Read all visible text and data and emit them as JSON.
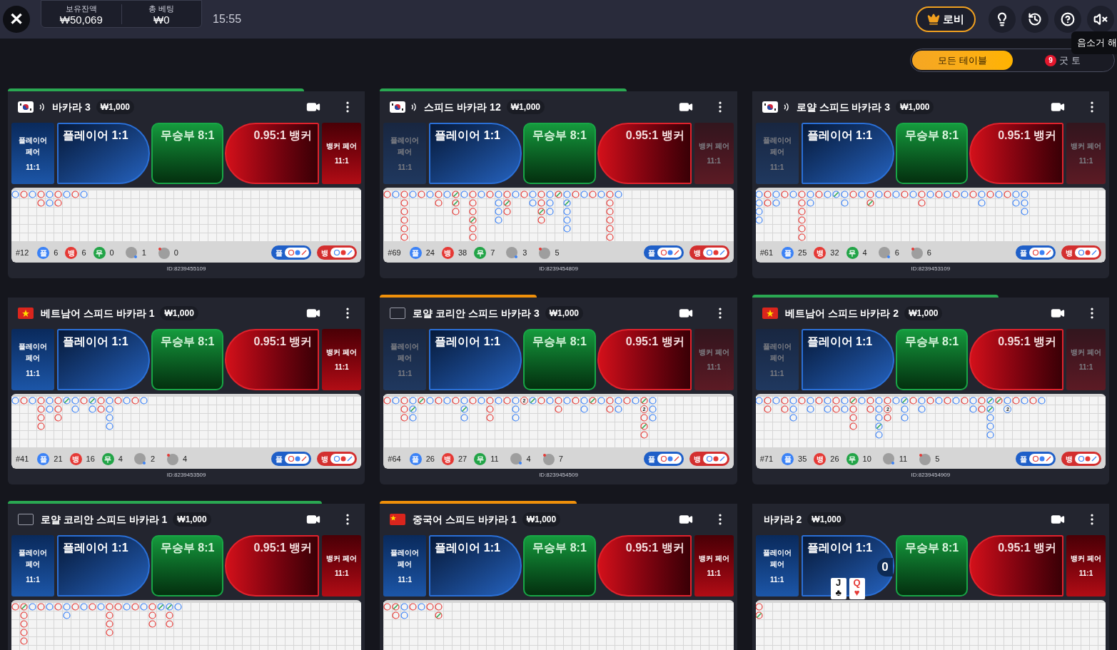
{
  "top_bar": {
    "close": "✕",
    "balance": {
      "label": "보유잔액",
      "value": "₩50,069"
    },
    "total_bet": {
      "label": "총 베팅",
      "value": "₩0"
    },
    "time": "15:55",
    "lobby": "로비",
    "tooltip": "음소거 해"
  },
  "tabs": [
    {
      "label": "모든 테이블",
      "selected": true
    },
    {
      "label": "굿 토",
      "selected": false,
      "badge": "9"
    }
  ],
  "tables": [
    {
      "flag": {
        "kind": "kr"
      },
      "sound": true,
      "title": "바카라 3",
      "min_bet": "₩1,000",
      "timer": {
        "level": 0.83,
        "color": "#2aa852"
      },
      "pairs_open": true,
      "player_pair": {
        "label": "플레이어 페어",
        "odds": "11:1"
      },
      "player": "플레이어 1:1",
      "tie": "무승부 8:1",
      "banker": "0.95:1 뱅커",
      "banker_pair": {
        "label": "뱅커 페어",
        "odds": "11:1"
      },
      "road": [
        [
          {
            "kind": "player"
          }
        ],
        [
          {
            "kind": "banker"
          }
        ],
        [
          {
            "kind": "player"
          }
        ],
        [
          {
            "kind": "banker"
          },
          {
            "kind": "banker"
          }
        ],
        [
          {
            "kind": "player"
          },
          {
            "kind": "player"
          }
        ],
        [
          {
            "kind": "banker"
          },
          {
            "kind": "banker"
          }
        ],
        [
          {
            "kind": "player"
          }
        ],
        [
          {
            "kind": "banker"
          }
        ],
        [
          {
            "kind": "player"
          }
        ]
      ],
      "stats": {
        "shoe": "#12",
        "player": {
          "label": "플",
          "count": "6"
        },
        "banker": {
          "label": "뱅",
          "count": "6"
        },
        "tie": {
          "label": "무",
          "count": "0"
        },
        "player_pair": "1",
        "banker_pair": "0"
      },
      "predict": [
        "플",
        "뱅"
      ],
      "id": "ID:8239455109"
    },
    {
      "flag": {
        "kind": "kr"
      },
      "sound": true,
      "title": "스피드 바카라 12",
      "min_bet": "₩1,000",
      "timer": {
        "level": 0.69,
        "color": "#2aa852"
      },
      "pairs_open": false,
      "player_pair": {
        "label": "플레이어 페어",
        "odds": "11:1"
      },
      "player": "플레이어 1:1",
      "tie": "무승부 8:1",
      "banker": "0.95:1 뱅커",
      "banker_pair": {
        "label": "뱅커 페어",
        "odds": "11:1"
      },
      "road": [
        [
          {
            "kind": "banker"
          }
        ],
        [
          {
            "kind": "player"
          }
        ],
        [
          {
            "kind": "banker"
          },
          {
            "kind": "banker"
          },
          {
            "kind": "banker"
          },
          {
            "kind": "banker"
          },
          {
            "kind": "banker"
          },
          {
            "kind": "banker"
          }
        ],
        [
          {
            "kind": "player"
          }
        ],
        [
          {
            "kind": "banker"
          }
        ],
        [
          {
            "kind": "player"
          }
        ],
        [
          {
            "kind": "banker"
          },
          {
            "kind": "banker"
          }
        ],
        [
          {
            "kind": "player"
          }
        ],
        [
          {
            "kind": "banker_tie"
          },
          {
            "kind": "banker_tie"
          },
          {
            "kind": "banker"
          }
        ],
        [
          {
            "kind": "player"
          }
        ],
        [
          {
            "kind": "banker"
          },
          {
            "kind": "banker"
          },
          {
            "kind": "banker"
          },
          {
            "kind": "banker_tie"
          },
          {
            "kind": "banker"
          },
          {
            "kind": "banker"
          }
        ],
        [
          {
            "kind": "player"
          }
        ],
        [
          {
            "kind": "banker"
          }
        ],
        [
          {
            "kind": "player"
          },
          {
            "kind": "player"
          },
          {
            "kind": "player"
          },
          {
            "kind": "player"
          }
        ],
        [
          {
            "kind": "banker"
          },
          {
            "kind": "banker_tie"
          },
          {
            "kind": "banker"
          }
        ],
        [
          {
            "kind": "player"
          }
        ],
        [
          {
            "kind": "banker"
          }
        ],
        [
          {
            "kind": "player"
          },
          {
            "kind": "player"
          }
        ],
        [
          {
            "kind": "banker"
          },
          {
            "kind": "banker"
          },
          {
            "kind": "banker_tie"
          },
          {
            "kind": "banker"
          }
        ],
        [
          {
            "kind": "player"
          },
          {
            "kind": "player"
          },
          {
            "kind": "player"
          }
        ],
        [
          {
            "kind": "banker_tie"
          }
        ],
        [
          {
            "kind": "player"
          },
          {
            "kind": "player_tie"
          },
          {
            "kind": "player"
          },
          {
            "kind": "player"
          },
          {
            "kind": "player"
          }
        ],
        [
          {
            "kind": "banker"
          }
        ],
        [
          {
            "kind": "player"
          }
        ],
        [
          {
            "kind": "banker"
          }
        ],
        [
          {
            "kind": "player"
          }
        ],
        [
          {
            "kind": "banker"
          },
          {
            "kind": "banker"
          },
          {
            "kind": "banker"
          },
          {
            "kind": "banker"
          },
          {
            "kind": "banker"
          },
          {
            "kind": "banker"
          }
        ],
        [
          {
            "kind": "player"
          }
        ]
      ],
      "stats": {
        "shoe": "#69",
        "player": {
          "label": "플",
          "count": "24"
        },
        "banker": {
          "label": "뱅",
          "count": "38"
        },
        "tie": {
          "label": "무",
          "count": "7"
        },
        "player_pair": "3",
        "banker_pair": "5"
      },
      "predict": [
        "플",
        "뱅"
      ],
      "id": "ID:8239454809"
    },
    {
      "flag": {
        "kind": "kr"
      },
      "sound": true,
      "title": "로얄 스피드 바카라 3",
      "min_bet": "₩1,000",
      "pairs_open": false,
      "player_pair": {
        "label": "플레이어 페어",
        "odds": "11:1"
      },
      "player": "플레이어 1:1",
      "tie": "무승부 8:1",
      "banker": "0.95:1 뱅커",
      "banker_pair": {
        "label": "뱅커 페어",
        "odds": "11:1"
      },
      "road": [
        [
          {
            "kind": "player"
          },
          {
            "kind": "player"
          },
          {
            "kind": "player"
          },
          {
            "kind": "player"
          }
        ],
        [
          {
            "kind": "banker"
          },
          {
            "kind": "banker"
          }
        ],
        [
          {
            "kind": "player"
          },
          {
            "kind": "player"
          }
        ],
        [
          {
            "kind": "banker"
          }
        ],
        [
          {
            "kind": "player"
          }
        ],
        [
          {
            "kind": "banker"
          },
          {
            "kind": "banker"
          },
          {
            "kind": "banker"
          },
          {
            "kind": "banker"
          },
          {
            "kind": "banker"
          },
          {
            "kind": "banker"
          }
        ],
        [
          {
            "kind": "player"
          },
          {
            "kind": "player"
          }
        ],
        [
          {
            "kind": "banker"
          }
        ],
        [
          {
            "kind": "player"
          }
        ],
        [
          {
            "kind": "player_tie"
          }
        ],
        [
          {
            "kind": "player"
          },
          {
            "kind": "player"
          }
        ],
        [
          {
            "kind": "banker"
          }
        ],
        [
          {
            "kind": "player"
          }
        ],
        [
          {
            "kind": "banker"
          },
          {
            "kind": "banker_tie"
          }
        ],
        [
          {
            "kind": "player"
          }
        ],
        [
          {
            "kind": "banker"
          }
        ],
        [
          {
            "kind": "player"
          }
        ],
        [
          {
            "kind": "banker"
          }
        ],
        [
          {
            "kind": "player"
          }
        ],
        [
          {
            "kind": "banker"
          },
          {
            "kind": "banker"
          }
        ],
        [
          {
            "kind": "player"
          }
        ],
        [
          {
            "kind": "banker"
          }
        ],
        [
          {
            "kind": "player"
          }
        ],
        [
          {
            "kind": "banker"
          }
        ],
        [
          {
            "kind": "player"
          }
        ],
        [
          {
            "kind": "banker"
          }
        ],
        [
          {
            "kind": "player"
          },
          {
            "kind": "player"
          }
        ],
        [
          {
            "kind": "banker"
          }
        ],
        [
          {
            "kind": "player"
          }
        ],
        [
          {
            "kind": "banker"
          }
        ],
        [
          {
            "kind": "player"
          },
          {
            "kind": "player"
          }
        ],
        [
          {
            "kind": "player"
          },
          {
            "kind": "player"
          },
          {
            "kind": "player"
          }
        ]
      ],
      "stats": {
        "shoe": "#61",
        "player": {
          "label": "플",
          "count": "25"
        },
        "banker": {
          "label": "뱅",
          "count": "32"
        },
        "tie": {
          "label": "무",
          "count": "4"
        },
        "player_pair": "6",
        "banker_pair": "6"
      },
      "predict": [
        "플",
        "뱅"
      ],
      "id": "ID:8239453109"
    },
    {
      "flag": {
        "kind": "vn"
      },
      "sound": false,
      "title": "베트남어 스피드 바카라 1",
      "min_bet": "₩1,000",
      "pairs_open": true,
      "player_pair": {
        "label": "플레이어 페어",
        "odds": "11:1"
      },
      "player": "플레이어 1:1",
      "tie": "무승부 8:1",
      "banker": "0.95:1 뱅커",
      "banker_pair": {
        "label": "뱅커 페어",
        "odds": "11:1"
      },
      "road": [
        [
          {
            "kind": "player"
          }
        ],
        [
          {
            "kind": "banker"
          }
        ],
        [
          {
            "kind": "player"
          }
        ],
        [
          {
            "kind": "banker"
          },
          {
            "kind": "banker"
          },
          {
            "kind": "banker"
          },
          {
            "kind": "banker"
          }
        ],
        [
          {
            "kind": "player"
          },
          {
            "kind": "player"
          }
        ],
        [
          {
            "kind": "banker"
          },
          {
            "kind": "banker"
          },
          {
            "kind": "banker"
          }
        ],
        [
          {
            "kind": "player_tie"
          }
        ],
        [
          {
            "kind": "player"
          },
          {
            "kind": "player"
          }
        ],
        [
          {
            "kind": "banker"
          }
        ],
        [
          {
            "kind": "player_tie"
          },
          {
            "kind": "player"
          }
        ],
        [
          {
            "kind": "banker"
          },
          {
            "kind": "banker"
          }
        ],
        [
          {
            "kind": "player"
          },
          {
            "kind": "player"
          },
          {
            "kind": "player"
          },
          {
            "kind": "player"
          }
        ],
        [
          {
            "kind": "banker"
          }
        ],
        [
          {
            "kind": "player"
          }
        ],
        [
          {
            "kind": "banker"
          }
        ],
        [
          {
            "kind": "player"
          }
        ]
      ],
      "stats": {
        "shoe": "#41",
        "player": {
          "label": "플",
          "count": "21"
        },
        "banker": {
          "label": "뱅",
          "count": "16"
        },
        "tie": {
          "label": "무",
          "count": "4"
        },
        "player_pair": "2",
        "banker_pair": "4"
      },
      "predict": [
        "플",
        "뱅"
      ],
      "id": "ID:8239453509"
    },
    {
      "flag": {
        "kind": "blank"
      },
      "sound": false,
      "title": "로얄 코리안 스피드 바카라 3",
      "min_bet": "₩1,000",
      "timer": {
        "level": 0.44,
        "color": "#f0900a"
      },
      "pairs_open": false,
      "player_pair": {
        "label": "플레이어 페어",
        "odds": "11:1"
      },
      "player": "플레이어 1:1",
      "tie": "무승부 8:1",
      "banker": "0.95:1 뱅커",
      "banker_pair": {
        "label": "뱅커 페어",
        "odds": "11:1"
      },
      "road": [
        [
          {
            "kind": "banker"
          }
        ],
        [
          {
            "kind": "player"
          }
        ],
        [
          {
            "kind": "banker"
          },
          {
            "kind": "banker"
          },
          {
            "kind": "banker"
          }
        ],
        [
          {
            "kind": "player"
          },
          {
            "kind": "player_tie"
          },
          {
            "kind": "player"
          }
        ],
        [
          {
            "kind": "banker_tie"
          }
        ],
        [
          {
            "kind": "player"
          }
        ],
        [
          {
            "kind": "banker"
          }
        ],
        [
          {
            "kind": "player"
          }
        ],
        [
          {
            "kind": "banker"
          }
        ],
        [
          {
            "kind": "player"
          },
          {
            "kind": "player_tie"
          },
          {
            "kind": "player"
          }
        ],
        [
          {
            "kind": "banker"
          }
        ],
        [
          {
            "kind": "player"
          }
        ],
        [
          {
            "kind": "banker"
          },
          {
            "kind": "banker"
          },
          {
            "kind": "banker"
          }
        ],
        [
          {
            "kind": "player"
          }
        ],
        [
          {
            "kind": "banker"
          }
        ],
        [
          {
            "kind": "player"
          },
          {
            "kind": "player"
          },
          {
            "kind": "player"
          }
        ],
        [
          {
            "kind": "banker",
            "count": "2"
          }
        ],
        [
          {
            "kind": "player_tie"
          }
        ],
        [
          {
            "kind": "banker"
          }
        ],
        [
          {
            "kind": "player"
          }
        ],
        [
          {
            "kind": "banker"
          },
          {
            "kind": "banker"
          }
        ],
        [
          {
            "kind": "player"
          }
        ],
        [
          {
            "kind": "banker"
          }
        ],
        [
          {
            "kind": "player"
          },
          {
            "kind": "player"
          }
        ],
        [
          {
            "kind": "banker_tie"
          }
        ],
        [
          {
            "kind": "player"
          }
        ],
        [
          {
            "kind": "banker"
          },
          {
            "kind": "banker"
          }
        ],
        [
          {
            "kind": "player"
          },
          {
            "kind": "player"
          }
        ],
        [
          {
            "kind": "banker"
          }
        ],
        [
          {
            "kind": "player"
          }
        ],
        [
          {
            "kind": "banker_tie"
          },
          {
            "kind": "banker",
            "count": "2"
          },
          {
            "kind": "banker"
          },
          {
            "kind": "banker_tie"
          },
          {
            "kind": "banker"
          }
        ],
        [
          {
            "kind": "player"
          },
          {
            "kind": "player"
          },
          {
            "kind": "player"
          }
        ]
      ],
      "stats": {
        "shoe": "#64",
        "player": {
          "label": "플",
          "count": "26"
        },
        "banker": {
          "label": "뱅",
          "count": "27"
        },
        "tie": {
          "label": "무",
          "count": "11"
        },
        "player_pair": "4",
        "banker_pair": "7"
      },
      "predict": [
        "플",
        "뱅"
      ],
      "id": "ID:8239454509"
    },
    {
      "flag": {
        "kind": "vn"
      },
      "sound": false,
      "title": "베트남어 스피드 바카라 2",
      "min_bet": "₩1,000",
      "timer": {
        "level": 0.69,
        "color": "#2aa852"
      },
      "pairs_open": false,
      "player_pair": {
        "label": "플레이어 페어",
        "odds": "11:1"
      },
      "player": "플레이어 1:1",
      "tie": "무승부 8:1",
      "banker": "0.95:1 뱅커",
      "banker_pair": {
        "label": "뱅커 페어",
        "odds": "11:1"
      },
      "road": [
        [
          {
            "kind": "player"
          }
        ],
        [
          {
            "kind": "banker"
          },
          {
            "kind": "banker"
          }
        ],
        [
          {
            "kind": "player"
          }
        ],
        [
          {
            "kind": "banker"
          },
          {
            "kind": "banker"
          }
        ],
        [
          {
            "kind": "player"
          },
          {
            "kind": "player"
          },
          {
            "kind": "player"
          }
        ],
        [
          {
            "kind": "banker"
          }
        ],
        [
          {
            "kind": "player"
          },
          {
            "kind": "player"
          }
        ],
        [
          {
            "kind": "banker"
          }
        ],
        [
          {
            "kind": "player"
          },
          {
            "kind": "player"
          }
        ],
        [
          {
            "kind": "banker"
          },
          {
            "kind": "banker"
          }
        ],
        [
          {
            "kind": "player"
          },
          {
            "kind": "player"
          }
        ],
        [
          {
            "kind": "banker_tie"
          },
          {
            "kind": "banker"
          },
          {
            "kind": "banker"
          },
          {
            "kind": "banker"
          }
        ],
        [
          {
            "kind": "player"
          }
        ],
        [
          {
            "kind": "banker"
          },
          {
            "kind": "banker"
          }
        ],
        [
          {
            "kind": "player"
          },
          {
            "kind": "player"
          },
          {
            "kind": "player"
          },
          {
            "kind": "player_tie"
          },
          {
            "kind": "player"
          }
        ],
        [
          {
            "kind": "banker"
          },
          {
            "kind": "banker",
            "count": "2"
          },
          {
            "kind": "banker"
          }
        ],
        [
          {
            "kind": "player"
          }
        ],
        [
          {
            "kind": "player_tie"
          },
          {
            "kind": "player"
          },
          {
            "kind": "player"
          }
        ],
        [
          {
            "kind": "banker"
          }
        ],
        [
          {
            "kind": "player"
          },
          {
            "kind": "player"
          }
        ],
        [
          {
            "kind": "banker"
          }
        ],
        [
          {
            "kind": "player"
          }
        ],
        [
          {
            "kind": "banker"
          }
        ],
        [
          {
            "kind": "player"
          }
        ],
        [
          {
            "kind": "banker"
          }
        ],
        [
          {
            "kind": "player"
          },
          {
            "kind": "player"
          }
        ],
        [
          {
            "kind": "banker"
          },
          {
            "kind": "banker"
          }
        ],
        [
          {
            "kind": "player_tie"
          },
          {
            "kind": "player_tie"
          },
          {
            "kind": "player"
          },
          {
            "kind": "player"
          },
          {
            "kind": "player"
          }
        ],
        [
          {
            "kind": "banker_tie"
          }
        ],
        [
          {
            "kind": "player"
          },
          {
            "kind": "player",
            "count": "2"
          }
        ],
        [
          {
            "kind": "banker"
          }
        ],
        [
          {
            "kind": "player"
          }
        ],
        [
          {
            "kind": "banker"
          }
        ],
        [
          {
            "kind": "player"
          }
        ]
      ],
      "stats": {
        "shoe": "#71",
        "player": {
          "label": "플",
          "count": "35"
        },
        "banker": {
          "label": "뱅",
          "count": "26"
        },
        "tie": {
          "label": "무",
          "count": "10"
        },
        "player_pair": "11",
        "banker_pair": "5"
      },
      "predict": [
        "플",
        "뱅"
      ],
      "id": "ID:8239454909"
    },
    {
      "flag": {
        "kind": "blank"
      },
      "sound": false,
      "title": "로얄 코리안 스피드 바카라 1",
      "min_bet": "₩1,000",
      "timer": {
        "level": 0.88,
        "color": "#2aa852"
      },
      "pairs_open": true,
      "player_pair": {
        "label": "플레이어 페어",
        "odds": "11:1"
      },
      "player": "플레이어 1:1",
      "tie": "무승부 8:1",
      "banker": "0.95:1 뱅커",
      "banker_pair": {
        "label": "뱅커 페어",
        "odds": "11:1"
      },
      "road": [
        [
          {
            "kind": "banker"
          }
        ],
        [
          {
            "kind": "banker_tie"
          },
          {
            "kind": "banker"
          },
          {
            "kind": "banker"
          },
          {
            "kind": "banker"
          },
          {
            "kind": "banker"
          }
        ],
        [
          {
            "kind": "player"
          }
        ],
        [
          {
            "kind": "banker"
          }
        ],
        [
          {
            "kind": "player"
          }
        ],
        [
          {
            "kind": "banker"
          }
        ],
        [
          {
            "kind": "player"
          },
          {
            "kind": "player"
          }
        ],
        [
          {
            "kind": "banker"
          }
        ],
        [
          {
            "kind": "player"
          }
        ],
        [
          {
            "kind": "banker"
          }
        ],
        [
          {
            "kind": "player"
          }
        ],
        [
          {
            "kind": "banker"
          },
          {
            "kind": "banker"
          },
          {
            "kind": "banker"
          },
          {
            "kind": "banker"
          }
        ],
        [
          {
            "kind": "banker"
          }
        ],
        [
          {
            "kind": "player"
          }
        ],
        [
          {
            "kind": "banker"
          }
        ],
        [
          {
            "kind": "player"
          }
        ],
        [
          {
            "kind": "banker"
          },
          {
            "kind": "banker"
          },
          {
            "kind": "banker"
          }
        ],
        [
          {
            "kind": "player_tie"
          }
        ],
        [
          {
            "kind": "player_tie"
          },
          {
            "kind": "banker"
          },
          {
            "kind": "banker"
          }
        ],
        [
          {
            "kind": "player"
          }
        ]
      ]
    },
    {
      "flag": {
        "kind": "cn"
      },
      "sound": false,
      "title": "중국어 스피드 바카라 1",
      "min_bet": "₩1,000",
      "timer": {
        "level": 0.55,
        "color": "#f0900a"
      },
      "pairs_open": true,
      "player_pair": {
        "label": "플레이어 페어",
        "odds": "11:1"
      },
      "player": "플레이어 1:1",
      "tie": "무승부 8:1",
      "banker": "0.95:1 뱅커",
      "banker_pair": {
        "label": "뱅커 페어",
        "odds": "11:1"
      },
      "road": [
        [
          {
            "kind": "banker"
          }
        ],
        [
          {
            "kind": "banker_tie"
          },
          {
            "kind": "banker"
          }
        ],
        [
          {
            "kind": "player"
          },
          {
            "kind": "player"
          }
        ],
        [
          {
            "kind": "banker"
          }
        ],
        [
          {
            "kind": "player"
          }
        ],
        [
          {
            "kind": "banker"
          }
        ],
        [
          {
            "kind": "banker"
          },
          {
            "kind": "banker_tie"
          }
        ]
      ]
    },
    {
      "flag": {
        "kind": "none"
      },
      "sound": false,
      "title": "바카라 2",
      "min_bet": "₩1,000",
      "pairs_open": true,
      "player_pair": {
        "label": "플레이어 페어",
        "odds": "11:1"
      },
      "player": "플레이어 1:1",
      "tie": "무승부 8:1",
      "banker": "0.95:1 뱅커",
      "banker_pair": {
        "label": "뱅커 페어",
        "odds": "11:1"
      },
      "hand": {
        "score": "0",
        "cards": [
          {
            "rank": "J",
            "suit": "♣",
            "red": false
          },
          {
            "rank": "Q",
            "suit": "♥",
            "red": true
          }
        ]
      },
      "road": [
        [
          {
            "kind": "banker"
          },
          {
            "kind": "banker_tie"
          }
        ]
      ]
    }
  ]
}
